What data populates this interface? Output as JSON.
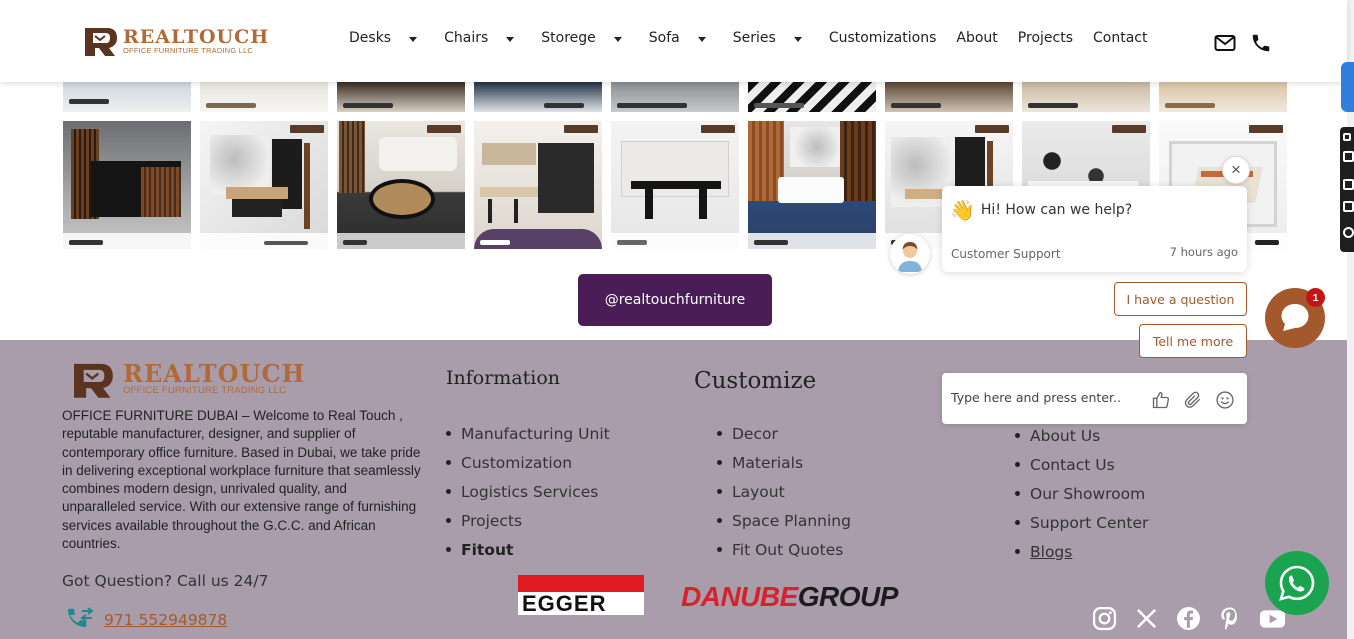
{
  "brand": {
    "name": "REALTOUCH",
    "tagline": "OFFICE FURNITURE TRADING LLC",
    "brand_color": "#b06a37"
  },
  "nav": {
    "items": [
      {
        "label": "Desks",
        "dropdown": true
      },
      {
        "label": "Chairs",
        "dropdown": true
      },
      {
        "label": "Storege",
        "dropdown": true
      },
      {
        "label": "Sofa",
        "dropdown": true
      },
      {
        "label": "Series",
        "dropdown": true
      },
      {
        "label": "Customizations",
        "dropdown": false
      },
      {
        "label": "About",
        "dropdown": false
      },
      {
        "label": "Projects",
        "dropdown": false
      },
      {
        "label": "Contact",
        "dropdown": false
      }
    ],
    "icons": [
      "mail-icon",
      "phone-icon"
    ]
  },
  "gallery": {
    "instagram_label": "@realtouchfurniture",
    "button_color": "#4a1d57"
  },
  "footer": {
    "background": "#a99dac",
    "about": "OFFICE FURNITURE DUBAI – Welcome to Real Touch , reputable manufacturer, designer, and supplier of contemporary office furniture. Based in Dubai, we take pride in delivering exceptional workplace furniture that seamlessly combines modern design, unrivaled quality, and unparalleled service. With our extensive range of furnishing services available throughout the G.C.C. and African countries.",
    "question": "Got Question? Call us 24/7",
    "phone": "971 552949878",
    "information": {
      "title": "Information",
      "items": [
        "Manufacturing Unit",
        "Customization",
        "Logistics Services",
        "Projects",
        "Fitout"
      ]
    },
    "customize": {
      "title": "Customize",
      "items": [
        "Decor",
        "Materials",
        "Layout",
        "Space Planning",
        "Fit Out Quotes"
      ]
    },
    "company": {
      "items": [
        "About Us",
        "Contact Us",
        "Our Showroom",
        "Support Center",
        "Blogs"
      ]
    },
    "partners": {
      "egger": "EGGER",
      "danube_1": "DANUBE",
      "danube_2": "GROUP"
    },
    "socials": [
      "instagram-icon",
      "x-icon",
      "facebook-icon",
      "pinterest-icon",
      "youtube-icon"
    ]
  },
  "chat": {
    "greeting": "Hi! How can we help?",
    "agent": "Customer Support",
    "time": "7 hours ago",
    "options": [
      "I have a question",
      "Tell me more"
    ],
    "input_placeholder": "Type here and press enter..",
    "badge": "1",
    "close": "×"
  }
}
